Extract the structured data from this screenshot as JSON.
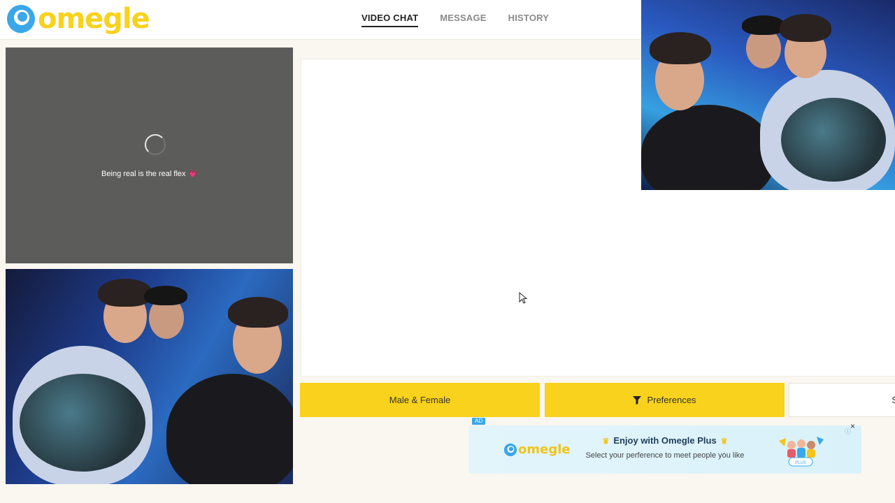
{
  "header": {
    "logo_text": "omegle",
    "nav": [
      {
        "label": "VIDEO CHAT",
        "active": true
      },
      {
        "label": "MESSAGE",
        "active": false
      },
      {
        "label": "HISTORY",
        "active": false
      }
    ]
  },
  "stranger_pane": {
    "status_text": "Being real is the real flex",
    "status_emoji": "💗"
  },
  "buttons": {
    "gender_label": "Male & Female",
    "preferences_label": "Preferences",
    "start_label_partial": "S"
  },
  "ad": {
    "tag": "AD",
    "logo_text": "omegle",
    "title": "Enjoy with Omegle Plus",
    "subtitle": "Select your perference to meet people you like",
    "close": "×",
    "badge_text": "PLUS"
  },
  "colors": {
    "brand_yellow": "#f8d21c",
    "brand_blue": "#3aa7e8",
    "page_bg": "#faf7f0"
  }
}
